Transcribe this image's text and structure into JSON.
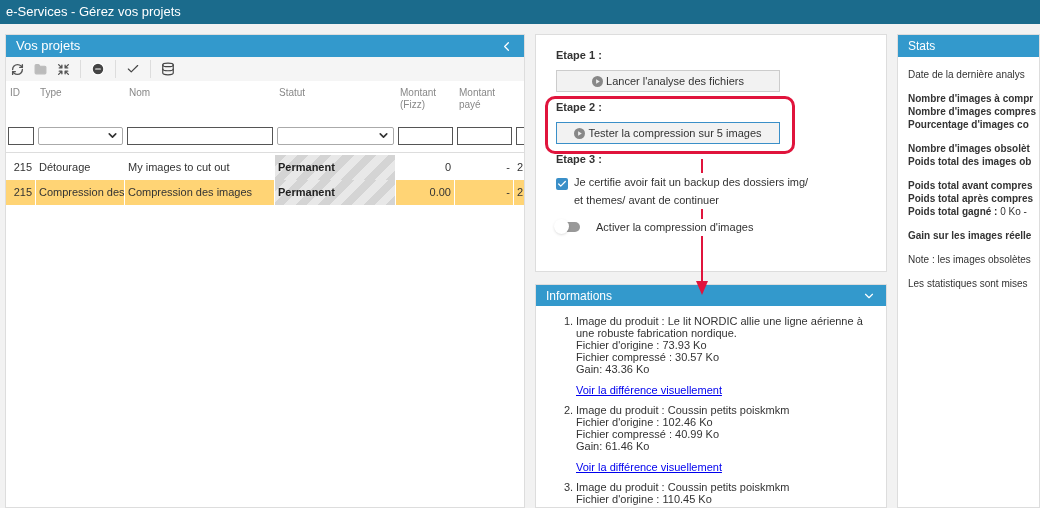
{
  "window": {
    "title": "e-Services - Gérez vos projets"
  },
  "projects": {
    "title": "Vos projets",
    "columns": [
      {
        "label": "ID",
        "kind": "number"
      },
      {
        "label": "Type",
        "kind": "choice"
      },
      {
        "label": "Nom",
        "kind": "text"
      },
      {
        "label": "Statut",
        "kind": "choice"
      },
      {
        "label": "Montant (Fizz)",
        "kind": "number"
      },
      {
        "label": "Montant payé",
        "kind": "number"
      },
      {
        "kind": "text"
      }
    ],
    "rows": [
      {
        "selected": false,
        "cells": [
          "215",
          "Détourage",
          "My images to cut out",
          "Permanent",
          "0",
          "-",
          "2"
        ]
      },
      {
        "selected": true,
        "cells": [
          "215",
          "Compression des",
          "Compression des images",
          "Permanent",
          "0.00",
          "-",
          "2"
        ]
      }
    ]
  },
  "steps": [
    {
      "label": "Etape 1 :",
      "kind": "button",
      "button": "Lancer l'analyse des fichiers",
      "highlighted": false
    },
    {
      "label": "Etape 2 :",
      "kind": "button",
      "button": "Tester la compression sur 5 images",
      "highlighted": true
    },
    {
      "label": "Etape 3 :",
      "kind": "options"
    }
  ],
  "backup_checkbox": {
    "label": "Je certifie avoir fait un backup des dossiers img/ et themes/ avant de continuer",
    "checked": true
  },
  "compression_toggle": {
    "label": "Activer la compression d'images",
    "on": false
  },
  "informations": {
    "title": "Informations",
    "expanded": true,
    "items": [
      {
        "number": "1.",
        "lines": [
          "Image du produit : Le lit NORDIC allie une ligne aérienne à une robuste fabrication nordique.",
          "Fichier d'origine : 73.93 Ko",
          "Fichier compressé : 30.57 Ko",
          "Gain: 43.36 Ko"
        ],
        "link": "Voir la différence visuellement"
      },
      {
        "number": "2.",
        "lines": [
          "Image du produit : Coussin petits poiskmkm",
          "Fichier d'origine : 102.46 Ko",
          "Fichier compressé : 40.99 Ko",
          "Gain: 61.46 Ko"
        ],
        "link": "Voir la différence visuellement"
      },
      {
        "number": "3.",
        "lines": [
          "Image du produit : Coussin petits poiskmkm",
          "Fichier d'origine : 110.45 Ko"
        ]
      }
    ]
  },
  "stats": {
    "title": "Stats",
    "groups": [
      {
        "bold": false,
        "lines": [
          "Date de la dernière analys"
        ]
      },
      {
        "bold": true,
        "lines": [
          "Nombre d'images à compr",
          "Nombre d'images compres",
          "Pourcentage d'images co"
        ]
      },
      {
        "bold": true,
        "lines": [
          "Nombre d'images obsolèt",
          "Poids total des images ob"
        ]
      },
      {
        "bold": false,
        "lines": [
          "**Poids total avant compres**",
          "**Poids total après compres**",
          "**Poids total gagné :** 0 Ko -"
        ]
      },
      {
        "bold": true,
        "lines": [
          "Gain sur les images réelle"
        ]
      },
      {
        "bold": false,
        "lines": [
          "Note : les images obsolètes"
        ]
      },
      {
        "bold": false,
        "lines": [
          "Les statistiques sont mises"
        ]
      }
    ]
  }
}
